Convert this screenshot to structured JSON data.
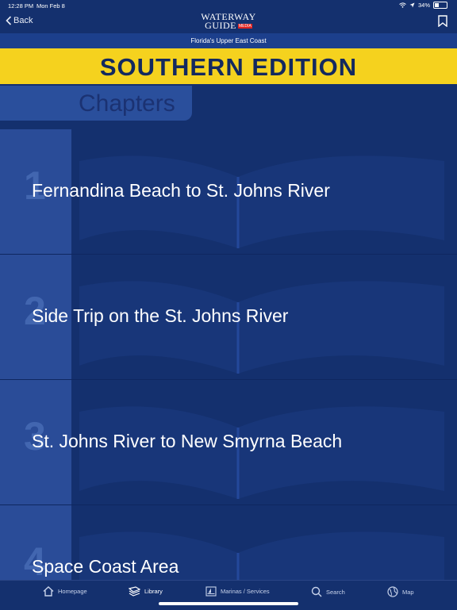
{
  "status": {
    "time": "12:28 PM",
    "date": "Mon Feb 8",
    "battery": "34%",
    "battery_level": 0.34
  },
  "nav": {
    "back_label": "Back",
    "logo_line1": "WATERWAY",
    "logo_line2": "GUIDE",
    "logo_badge": "MEDIA",
    "subtitle": "Florida's Upper East Coast"
  },
  "banner": "SOUTHERN EDITION",
  "section_title": "Chapters",
  "chapters": [
    {
      "number": "1",
      "title": "Fernandina Beach to St. Johns River"
    },
    {
      "number": "2",
      "title": "Side Trip on the St. Johns River"
    },
    {
      "number": "3",
      "title": "St. Johns River to New Smyrna Beach"
    },
    {
      "number": "4",
      "title": "Space Coast Area"
    }
  ],
  "tabs": [
    {
      "label": "Homepage",
      "icon": "home-icon"
    },
    {
      "label": "Library",
      "icon": "library-icon"
    },
    {
      "label": "Marinas / Services",
      "icon": "marina-icon"
    },
    {
      "label": "Search",
      "icon": "search-icon"
    },
    {
      "label": "Map",
      "icon": "globe-icon"
    }
  ],
  "colors": {
    "background": "#14306e",
    "banner": "#f5d21e",
    "banner_text": "#13295f"
  }
}
